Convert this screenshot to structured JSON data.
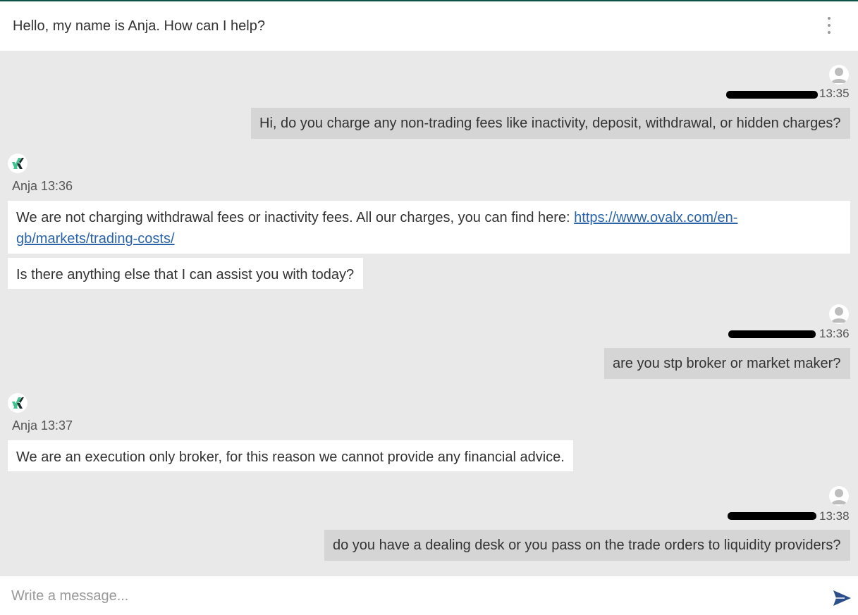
{
  "header": {
    "title": "Hello, my name is Anja. How can I help?",
    "menu_icon": "more-vertical-icon"
  },
  "messages": [
    {
      "sender": "user",
      "time": "13:35",
      "text": "Hi, do you charge any non-trading fees like inactivity, deposit, withdrawal, or hidden charges?"
    },
    {
      "sender": "agent",
      "meta": "Anja 13:36",
      "bubbles": [
        {
          "text": "We are not charging withdrawal fees or inactivity fees. All our charges, you can find here: ",
          "link": "https://www.ovalx.com/en-gb/markets/trading-costs/"
        },
        {
          "text": "Is there anything else that I can assist you with today?"
        }
      ]
    },
    {
      "sender": "user",
      "time": "13:36",
      "text": "are you stp broker or market maker?"
    },
    {
      "sender": "agent",
      "meta": "Anja 13:37",
      "bubbles": [
        {
          "text": "We are an execution only broker, for this reason we cannot provide any financial advice."
        }
      ]
    },
    {
      "sender": "user",
      "time": "13:38",
      "text": "do you have a dealing desk or you pass on the trade orders to liquidity providers?"
    }
  ],
  "composer": {
    "placeholder": "Write a message...",
    "value": "",
    "send_icon": "send-icon"
  },
  "colors": {
    "accent": "#0e5247",
    "chat_background": "#e9e9e9",
    "user_bubble": "#d5d5d5",
    "agent_bubble": "#ffffff",
    "link": "#2a63a8",
    "send_icon": "#2a4f8a",
    "logo_green": "#3fc38f"
  }
}
